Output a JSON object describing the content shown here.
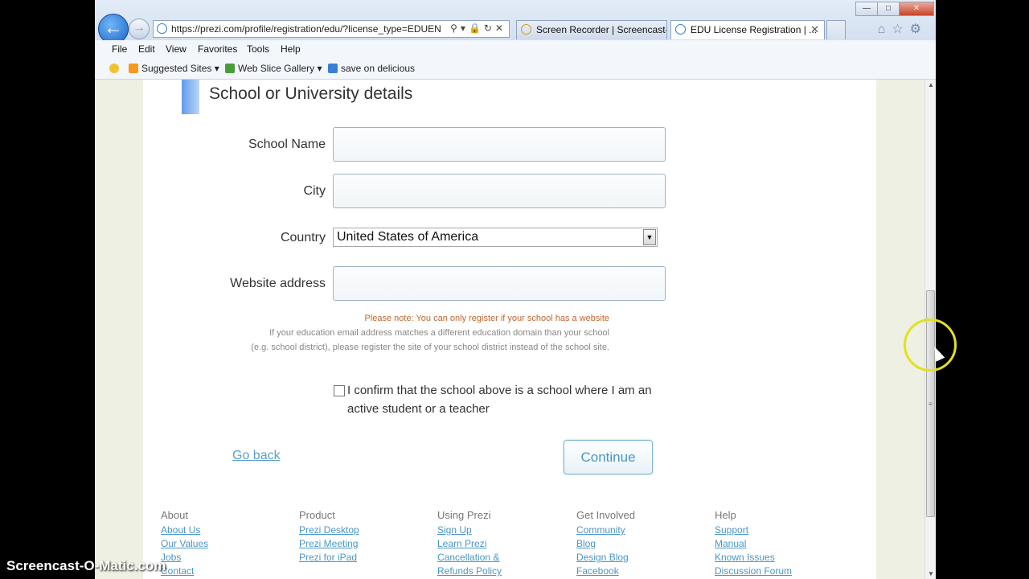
{
  "browser": {
    "url": "https://prezi.com/profile/registration/edu/?license_type=EDUEN",
    "tabs": [
      {
        "label": "Screen Recorder | Screencast-...",
        "active": false
      },
      {
        "label": "EDU License Registration | ...",
        "active": true
      }
    ],
    "menu": [
      "File",
      "Edit",
      "View",
      "Favorites",
      "Tools",
      "Help"
    ],
    "favorites": [
      {
        "label": "Suggested Sites ▾",
        "icon": "suggested-sites-icon"
      },
      {
        "label": "Web Slice Gallery ▾",
        "icon": "web-slice-icon"
      },
      {
        "label": "save on delicious",
        "icon": "delicious-icon"
      }
    ]
  },
  "form": {
    "section_title": "School or University details",
    "school_name_label": "School Name",
    "city_label": "City",
    "country_label": "Country",
    "country_value": "United States of America",
    "website_label": "Website address",
    "note_warning": "Please note: You can only register if your school has a website",
    "note_line2": "If your education email address matches a different education domain than your school",
    "note_line3": "(e.g. school district), please register the site of your school district instead of the school site.",
    "confirm_label": "I confirm that the school above is a school where I am an active student or a teacher",
    "go_back": "Go back",
    "continue": "Continue"
  },
  "footer": [
    {
      "heading": "About",
      "links": [
        "About Us",
        "Our Values",
        "Jobs",
        "Contact"
      ]
    },
    {
      "heading": "Product",
      "links": [
        "Prezi Desktop",
        "Prezi Meeting",
        "Prezi for iPad"
      ]
    },
    {
      "heading": "Using Prezi",
      "links": [
        "Sign Up",
        "Learn Prezi",
        "Cancellation &",
        "Refunds Policy"
      ]
    },
    {
      "heading": "Get Involved",
      "links": [
        "Community",
        "Blog",
        "Design Blog",
        "Facebook"
      ]
    },
    {
      "heading": "Help",
      "links": [
        "Support",
        "Manual",
        "Known Issues",
        "Discussion Forum"
      ]
    }
  ],
  "watermark": "Screencast-O-Matic.com",
  "colors": {
    "link": "#4a96c4",
    "warning": "#c0662d",
    "page_bg": "#eef0e3"
  }
}
